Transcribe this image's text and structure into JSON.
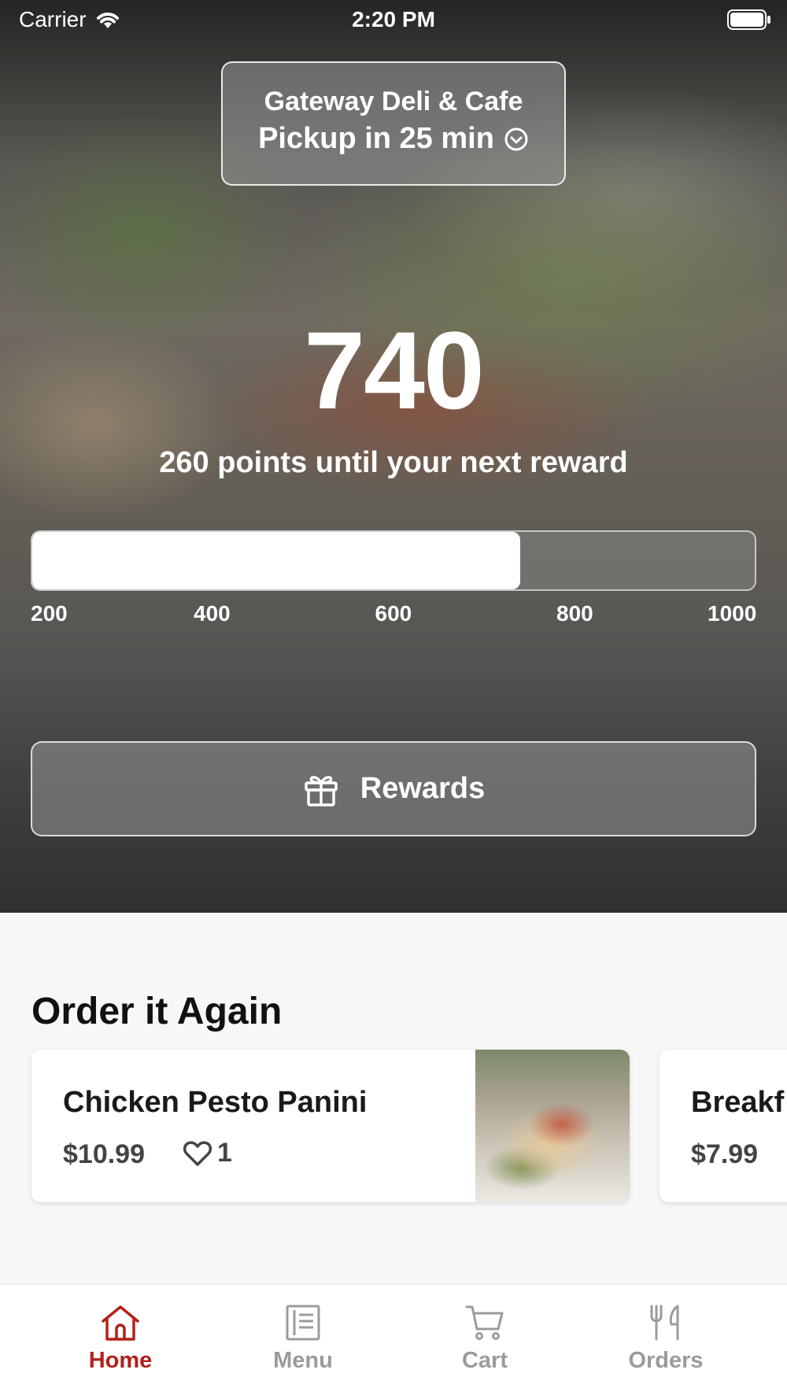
{
  "status_bar": {
    "carrier": "Carrier",
    "time": "2:20 PM"
  },
  "location": {
    "name": "Gateway Deli & Cafe",
    "pickup": "Pickup in 25 min"
  },
  "rewards": {
    "points": "740",
    "caption": "260 points until your next reward",
    "progress": {
      "min": 200,
      "max": 1000,
      "value": 740,
      "tick_labels": [
        "200",
        "400",
        "600",
        "800",
        "1000"
      ]
    },
    "button_label": "Rewards"
  },
  "order_again": {
    "title": "Order it Again",
    "items": [
      {
        "name": "Chicken Pesto Panini",
        "price": "$10.99",
        "likes": "1"
      },
      {
        "name": "Breakf",
        "price": "$7.99"
      }
    ]
  },
  "tab_bar": {
    "tabs": [
      {
        "label": "Home",
        "icon": "home-icon",
        "active": true
      },
      {
        "label": "Menu",
        "icon": "menu-icon",
        "active": false
      },
      {
        "label": "Cart",
        "icon": "cart-icon",
        "active": false
      },
      {
        "label": "Orders",
        "icon": "utensils-icon",
        "active": false
      }
    ]
  },
  "colors": {
    "accent": "#b3201c",
    "inactive_tab": "#9b9b9b",
    "background": "#f7f7f7"
  }
}
